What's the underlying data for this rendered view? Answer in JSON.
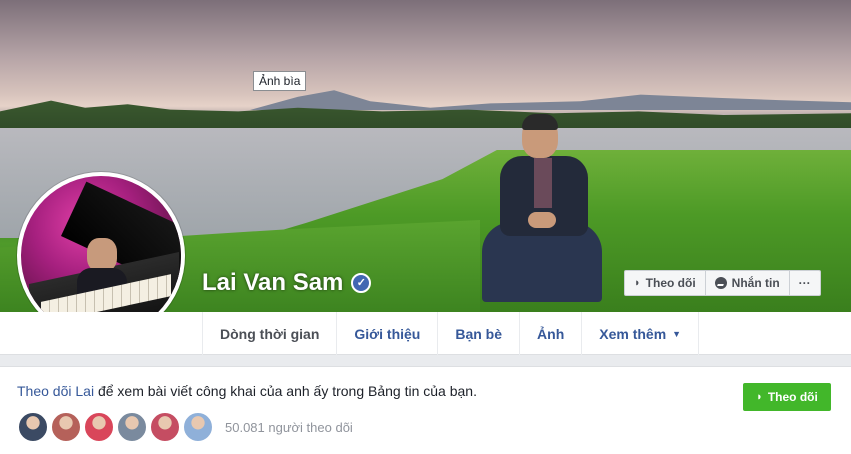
{
  "cover": {
    "tooltip": "Ảnh bìa"
  },
  "profile": {
    "name": "Lai Van Sam",
    "verified_glyph": "✓"
  },
  "cover_actions": [
    {
      "icon": "rss-icon",
      "label": "Theo dõi"
    },
    {
      "icon": "messenger-icon",
      "label": "Nhắn tin"
    },
    {
      "icon": "more-icon",
      "label": "···"
    }
  ],
  "nav": {
    "tabs": [
      {
        "label": "Dòng thời gian"
      },
      {
        "label": "Giới thiệu"
      },
      {
        "label": "Bạn bè"
      },
      {
        "label": "Ảnh"
      },
      {
        "label": "Xem thêm",
        "caret": "▼"
      }
    ]
  },
  "follow": {
    "link_text": "Theo dõi Lai",
    "rest_text": " để xem bài viết công khai của anh ấy trong Bảng tin của bạn.",
    "button_label": "Theo dõi",
    "followers_count": "50.081 người theo dõi",
    "avatar_colors": [
      "#3b4a63",
      "#b5615a",
      "#d9465a",
      "#7a8a9e",
      "#c54d62",
      "#8fb0d9"
    ]
  },
  "colors": {
    "accent": "#365899",
    "follow_green": "#42b72a"
  }
}
